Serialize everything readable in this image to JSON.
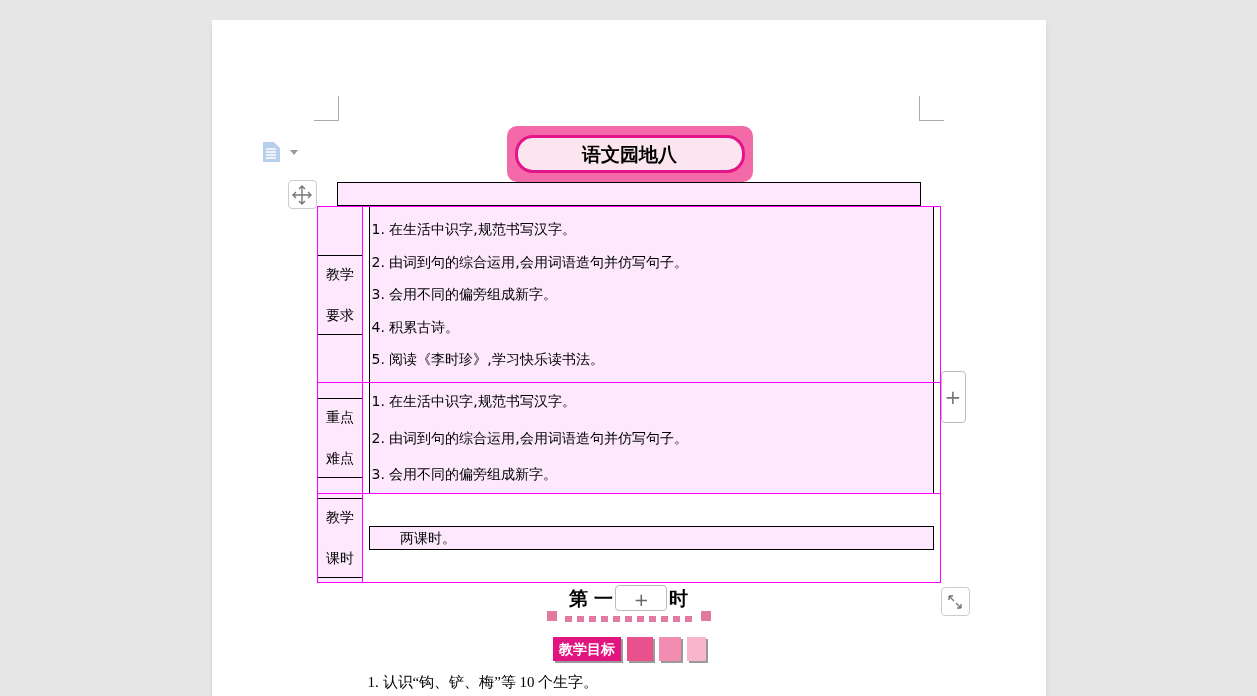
{
  "banner": {
    "title": "语文园地八"
  },
  "table": {
    "rows": [
      {
        "label": [
          "教学",
          "要求"
        ],
        "kind": "list",
        "items": [
          "1. 在生活中识字,规范书写汉字。",
          "2. 由词到句的综合运用,会用词语造句并仿写句子。",
          "3. 会用不同的偏旁组成新字。",
          "4. 积累古诗。",
          "5. 阅读《李时珍》,学习快乐读书法。"
        ]
      },
      {
        "label": [
          "重点",
          "难点"
        ],
        "kind": "list",
        "items": [
          "1. 在生活中识字,规范书写汉字。",
          "2. 由词到句的综合运用,会用词语造句并仿写句子。",
          "3. 会用不同的偏旁组成新字。"
        ]
      },
      {
        "label": [
          "教学",
          "课时"
        ],
        "kind": "box",
        "items": [
          "两课时。"
        ]
      }
    ]
  },
  "section": {
    "heading_left": "第 一",
    "add_button": "+",
    "heading_right": "时",
    "badge": "教学目标"
  },
  "body": [
    "1. 认识“钩、铲、梅”等 10 个生字。"
  ],
  "side": {
    "add_row": "+"
  }
}
